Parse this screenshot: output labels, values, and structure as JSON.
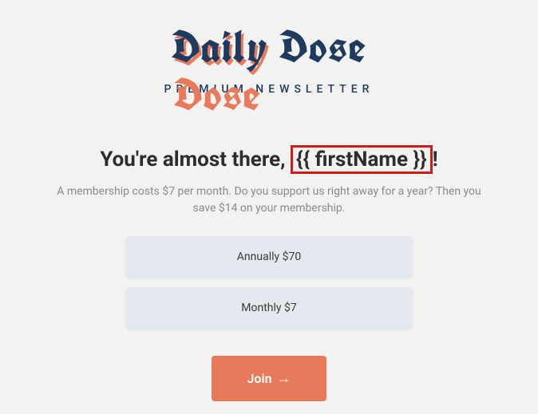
{
  "brand": {
    "name": "Daily Dose",
    "tagline": "PREMIUM NEWSLETTER"
  },
  "headline": {
    "prefix": "You're almost there, ",
    "placeholder": "{{ firstName }}",
    "suffix": "!"
  },
  "description": "A membership costs $7 per month. Do you support us right away for a year? Then you save $14 on your membership.",
  "plans": {
    "annual": "Annually $70",
    "monthly": "Monthly $7"
  },
  "cta": {
    "label": "Join",
    "arrow": "→"
  }
}
